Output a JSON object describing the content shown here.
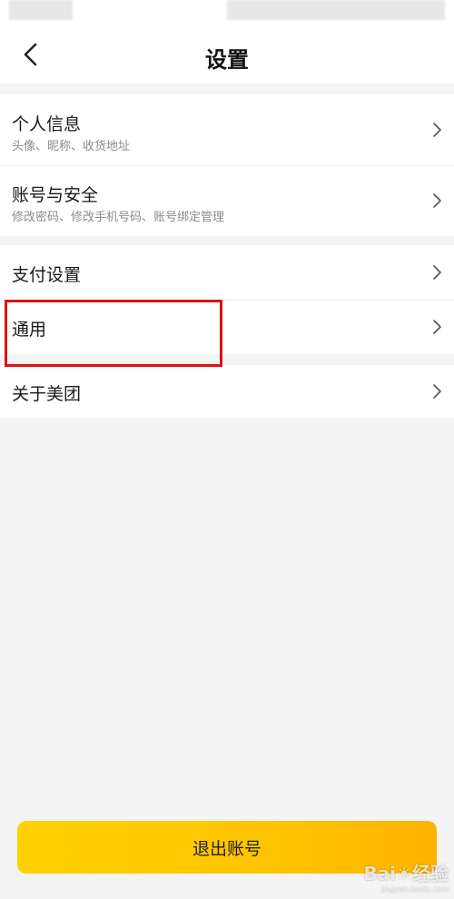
{
  "header": {
    "title": "设置",
    "back_icon": "chevron-left-icon"
  },
  "groups": [
    {
      "items": [
        {
          "title": "个人信息",
          "subtitle": "头像、昵称、收货地址"
        },
        {
          "title": "账号与安全",
          "subtitle": "修改密码、修改手机号码、账号绑定管理"
        }
      ]
    },
    {
      "items": [
        {
          "title": "支付设置"
        },
        {
          "title": "通用"
        }
      ]
    },
    {
      "items": [
        {
          "title": "关于美团"
        }
      ]
    }
  ],
  "logout": {
    "label": "退出账号"
  },
  "annotation": {
    "highlight_color": "#e01010",
    "highlighted_item": "通用"
  },
  "colors": {
    "accent": "#ffc400",
    "background": "#f4f4f4"
  },
  "watermark": {
    "brand": "Bai",
    "symbol": "☀",
    "suffix": "经验",
    "url": "jingyan.baidu.com"
  }
}
